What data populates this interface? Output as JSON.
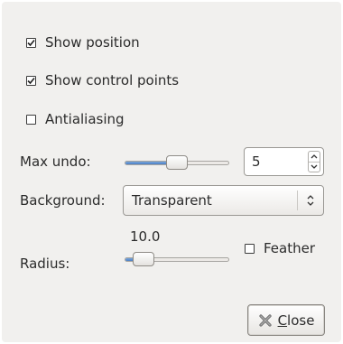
{
  "options": {
    "show_position": {
      "label": "Show position",
      "checked": true
    },
    "show_control_points": {
      "label": "Show control points",
      "checked": true
    },
    "antialiasing": {
      "label": "Antialiasing",
      "checked": false
    }
  },
  "max_undo": {
    "label": "Max undo:",
    "value": "5",
    "slider_fraction": 0.5
  },
  "background": {
    "label": "Background:",
    "selected": "Transparent"
  },
  "radius": {
    "label": "Radius:",
    "value_text": "10.0",
    "slider_fraction": 0.1
  },
  "feather": {
    "label": "Feather",
    "checked": false
  },
  "close_button": {
    "mnemonic": "C",
    "label_rest": "lose"
  },
  "icons": {
    "check": "check-mark-icon",
    "spin_up": "chevron-up-icon",
    "spin_down": "chevron-down-icon",
    "combo": "up-down-chevrons-icon",
    "close": "close-x-icon"
  },
  "colors": {
    "dialog_bg": "#f1f0ee",
    "slider_fill": "#4a7fc4"
  }
}
